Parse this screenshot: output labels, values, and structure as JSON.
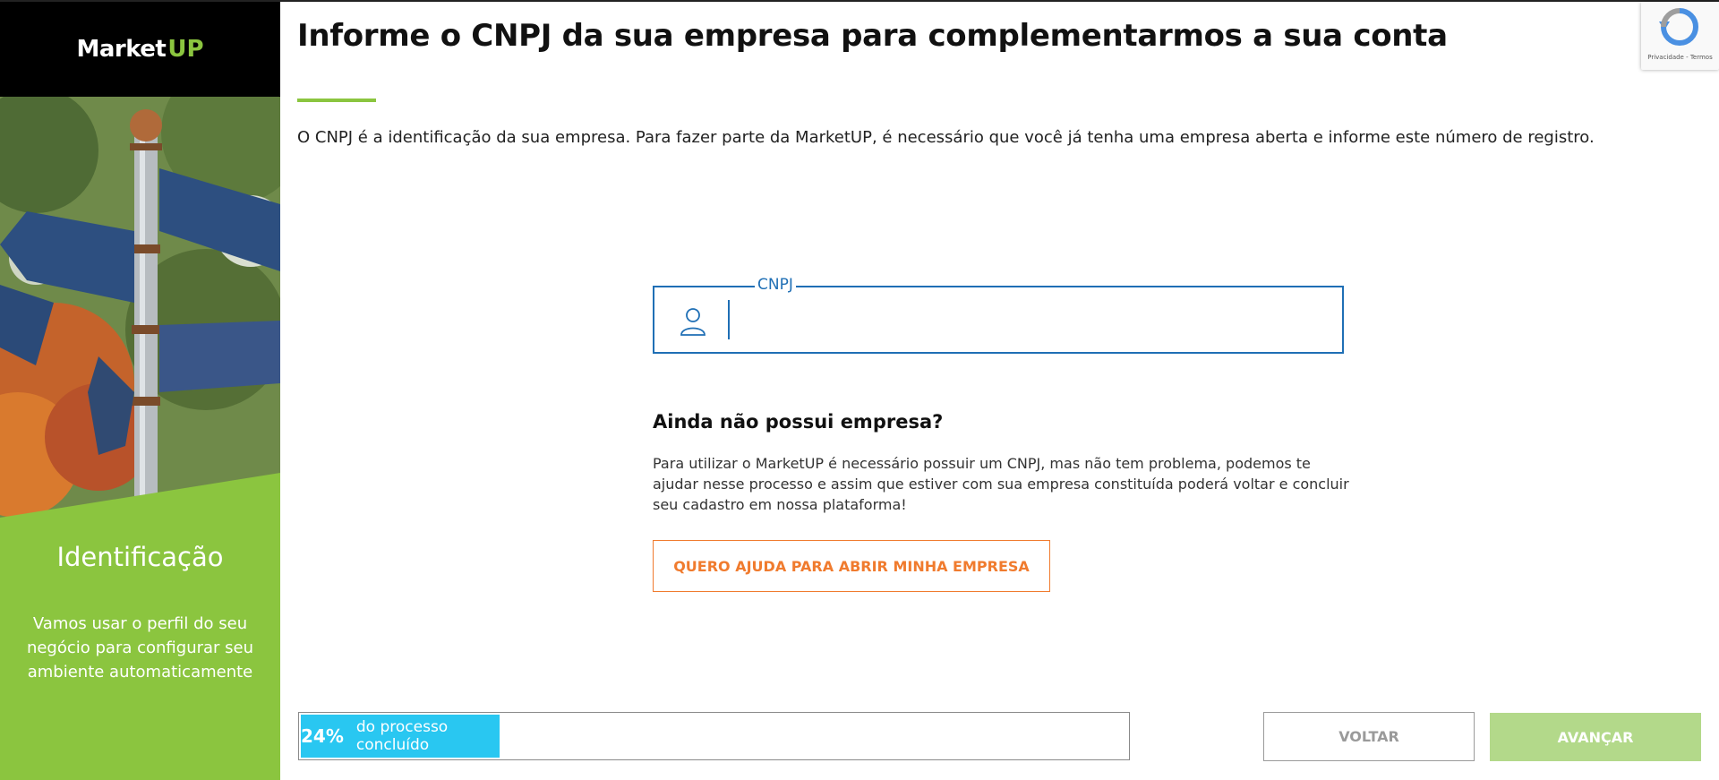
{
  "brand": {
    "logo_part1": "Market",
    "logo_part2": "UP",
    "accent": "#8bc53f"
  },
  "sidebar": {
    "title": "Identificação",
    "description": "Vamos usar o perfil do seu negócio para configurar seu ambiente automaticamente",
    "background": "#8bc53f"
  },
  "main": {
    "title": "Informe o CNPJ da sua empresa para complementarmos a sua conta",
    "intro": "O CNPJ é a identificação da sua empresa. Para fazer parte da MarketUP, é necessário que você já tenha uma empresa aberta e informe este número de registro.",
    "cnpj_field": {
      "label": "CNPJ",
      "value": "",
      "icon": "user-icon"
    },
    "question_title": "Ainda não possui empresa?",
    "question_text": "Para utilizar o MarketUP é necessário possuir um CNPJ, mas não tem problema, podemos te ajudar nesse processo e assim que estiver com sua empresa constituída poderá voltar e concluir seu cadastro em nossa plataforma!",
    "help_button": "QUERO AJUDA PARA ABRIR MINHA EMPRESA"
  },
  "footer": {
    "progress": {
      "percent_value": 24,
      "percent": "24%",
      "label": "do processo concluído",
      "color": "#29c7f1"
    },
    "back_button": "VOLTAR",
    "next_button": "AVANÇAR"
  },
  "recaptcha": {
    "text": "Privacidade - Termos"
  }
}
